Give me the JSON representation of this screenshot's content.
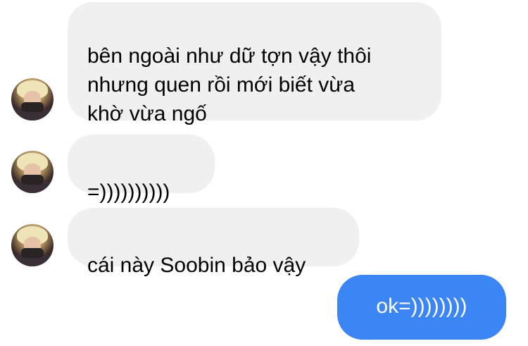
{
  "messages": [
    {
      "sender": "incoming",
      "text": "bên ngoài như dữ tợn vậy thôi\nnhưng quen rồi mới biết vừa\nkhờ vừa ngố"
    },
    {
      "sender": "incoming",
      "text": "=))))))))))"
    },
    {
      "sender": "incoming",
      "text": "cái này Soobin bảo vậy"
    },
    {
      "sender": "outgoing",
      "text": "ok=))))))))"
    }
  ],
  "colors": {
    "incoming_bubble": "#f0f0f0",
    "outgoing_bubble": "#3c85f5",
    "background": "#ffffff"
  },
  "icons": {
    "avatar": "contact-avatar-icon"
  }
}
